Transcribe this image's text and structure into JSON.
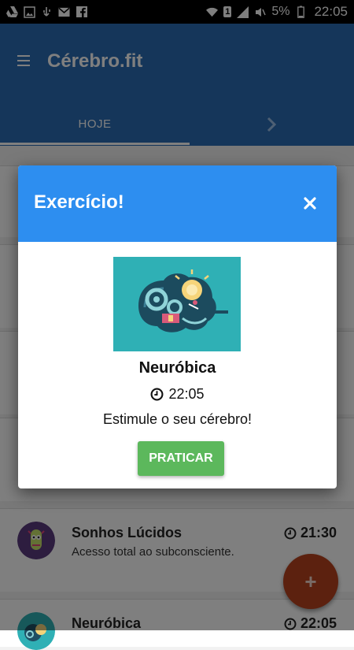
{
  "status_bar": {
    "sim_badge": "1",
    "battery": "5%",
    "time": "22:05"
  },
  "app_bar": {
    "title": "Cérebro.fit",
    "tabs": [
      {
        "label": "HOJE"
      }
    ],
    "icons": {
      "menu": "menu-icon",
      "next": "chevron-right-icon"
    }
  },
  "list": {
    "items": [
      {
        "title": "Sonhos Lúcidos",
        "subtitle": "Acesso total ao subconsciente.",
        "time": "21:30",
        "icon": "dream-avatar"
      },
      {
        "title": "Neuróbica",
        "time": "22:05",
        "icon": "brain-avatar"
      }
    ]
  },
  "fab": {
    "label": "+"
  },
  "dialog": {
    "title": "Exercício!",
    "exercise_name": "Neuróbica",
    "time": "22:05",
    "description": "Estimule o seu cérebro!",
    "button": "PRATICAR",
    "icons": {
      "close": "close-icon",
      "clock": "clock-icon",
      "image": "brain-illustration"
    }
  },
  "colors": {
    "app_bar": "#2a6db5",
    "dialog_header": "#2d8ef0",
    "practice_button": "#5cb85c",
    "fab": "#b8431f"
  }
}
